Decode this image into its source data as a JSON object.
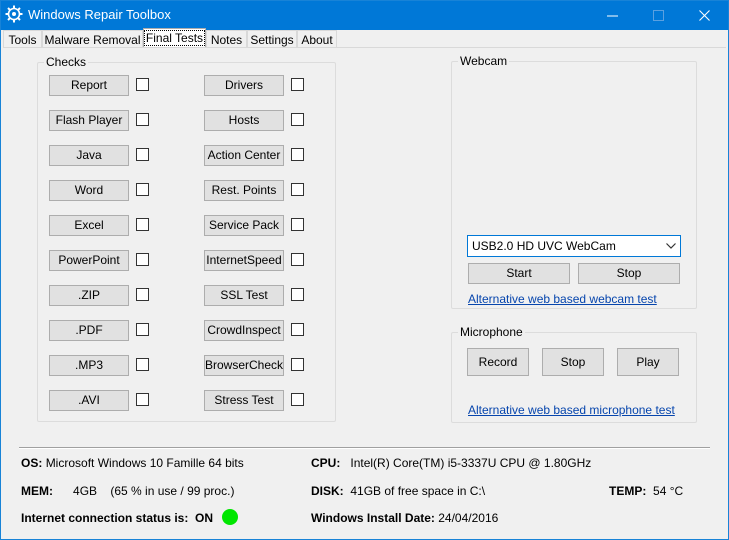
{
  "window": {
    "title": "Windows Repair Toolbox"
  },
  "tabs": [
    {
      "label": "Tools"
    },
    {
      "label": "Malware Removal"
    },
    {
      "label": "Final Tests"
    },
    {
      "label": "Notes"
    },
    {
      "label": "Settings"
    },
    {
      "label": "About"
    }
  ],
  "checks": {
    "title": "Checks",
    "left": [
      "Report",
      "Flash Player",
      "Java",
      "Word",
      "Excel",
      "PowerPoint",
      ".ZIP",
      ".PDF",
      ".MP3",
      ".AVI"
    ],
    "right": [
      "Drivers",
      "Hosts",
      "Action Center",
      "Rest. Points",
      "Service Pack",
      "InternetSpeed",
      "SSL Test",
      "CrowdInspect",
      "BrowserCheck",
      "Stress Test"
    ]
  },
  "webcam": {
    "title": "Webcam",
    "device": "USB2.0 HD UVC WebCam",
    "start_label": "Start",
    "stop_label": "Stop",
    "alt_link": "Alternative web based webcam test"
  },
  "microphone": {
    "title": "Microphone",
    "record_label": "Record",
    "stop_label": "Stop",
    "play_label": "Play",
    "alt_link": "Alternative web based microphone test"
  },
  "system": {
    "os_label": "OS:",
    "os_value": "Microsoft Windows 10 Famille 64 bits",
    "cpu_label": "CPU:",
    "cpu_value": "Intel(R) Core(TM) i5-3337U CPU @ 1.80GHz",
    "mem_label": "MEM:",
    "mem_value": "4GB",
    "mem_usage": "(65 % in use / 99 proc.)",
    "disk_label": "DISK:",
    "disk_value": "41GB of free space in C:\\",
    "temp_label": "TEMP:",
    "temp_value": "54 °C",
    "internet_label": "Internet connection status is:",
    "internet_value": "ON",
    "install_label": "Windows Install Date:",
    "install_value": "24/04/2016"
  },
  "colors": {
    "titlebar": "#0078d7",
    "status_on": "#00e600",
    "link": "#0645ad"
  }
}
